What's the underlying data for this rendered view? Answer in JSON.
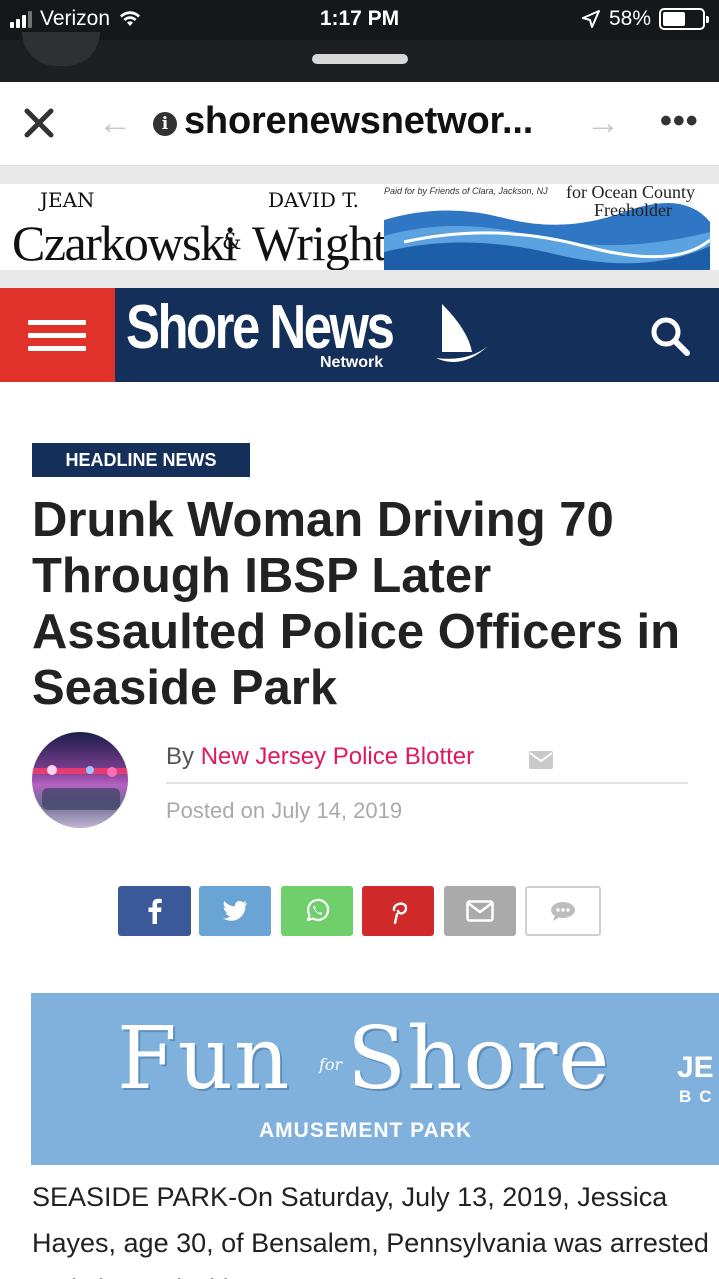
{
  "status_bar": {
    "carrier": "Verizon",
    "time": "1:17 PM",
    "battery": "58%",
    "battery_level": 0.58,
    "icons": [
      "signal-icon",
      "wifi-icon",
      "location-arrow-icon",
      "battery-icon"
    ]
  },
  "browser": {
    "url": "shorenewsnetwor...",
    "icons": [
      "close-icon",
      "back-arrow-icon",
      "info-icon",
      "forward-arrow-icon",
      "more-icon"
    ]
  },
  "top_ad": {
    "first_name_1": "JEAN",
    "last_name_1": "Czarkowski",
    "ampersand": "&",
    "first_name_2": "DAVID T.",
    "last_name_2": "Wright",
    "paid_for": "Paid for by Friends of Clara, Jackson, NJ",
    "for_line": "for Ocean County",
    "office": "Freeholder"
  },
  "site_header": {
    "logo_title": "Shore News",
    "logo_sub": "Network",
    "colors": {
      "nav_blue": "#14305a",
      "menu_red": "#e0312a"
    },
    "icons": [
      "hamburger-menu-icon",
      "sailboat-icon",
      "search-icon"
    ]
  },
  "article": {
    "category": "HEADLINE NEWS",
    "title": "Drunk Woman Driving 70 Through IBSP Later Assaulted Police Officers in Seaside Park",
    "by": "By",
    "author": "New Jersey Police Blotter",
    "posted": "Posted on July 14, 2019",
    "author_color": "#e0195c",
    "body": "SEASIDE PARK-On Saturday, July 13, 2019, Jessica Hayes, age 30, of Bensalem, Pennsylvania was arrested and charged with"
  },
  "share_buttons": [
    {
      "name": "facebook",
      "icon": "facebook-icon",
      "color": "#3b5998"
    },
    {
      "name": "twitter",
      "icon": "twitter-icon",
      "color": "#6aa4d4"
    },
    {
      "name": "whatsapp",
      "icon": "whatsapp-icon",
      "color": "#6fcf6a"
    },
    {
      "name": "pinterest",
      "icon": "pinterest-icon",
      "color": "#d12a2a"
    },
    {
      "name": "email",
      "icon": "email-icon",
      "color": "#aaaaaa"
    },
    {
      "name": "comments",
      "icon": "comment-icon",
      "color": "#ffffff"
    }
  ],
  "mid_ad": {
    "title_left": "Fun",
    "title_for": "for",
    "title_right": "Shore",
    "subtitle": "AMUSEMENT PARK",
    "edge_top": "JE",
    "edge_bottom": "BC"
  }
}
